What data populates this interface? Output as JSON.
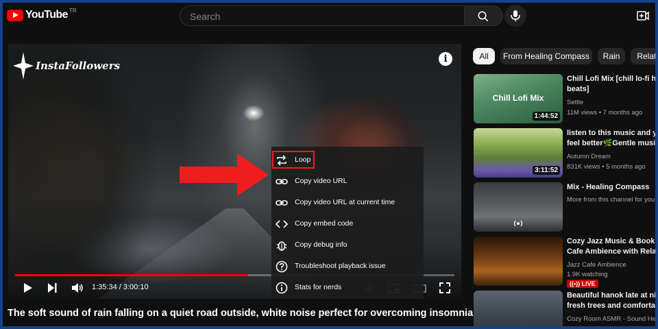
{
  "brand": {
    "name": "YouTube",
    "country": "TR"
  },
  "search": {
    "placeholder": "Search"
  },
  "player": {
    "watermark": "InstaFollowers",
    "progress_fraction": 0.53,
    "time_current": "1:35:34",
    "time_total": "3:00:10",
    "time_display": "1:35:34 / 3:00:10"
  },
  "context_menu": {
    "items": [
      {
        "label": "Loop",
        "icon": "loop-icon"
      },
      {
        "label": "Copy video URL",
        "icon": "link-icon"
      },
      {
        "label": "Copy video URL at current time",
        "icon": "link-icon"
      },
      {
        "label": "Copy embed code",
        "icon": "code-icon"
      },
      {
        "label": "Copy debug info",
        "icon": "bug-icon"
      },
      {
        "label": "Troubleshoot playback issue",
        "icon": "question-icon"
      },
      {
        "label": "Stats for nerds",
        "icon": "info-icon"
      }
    ]
  },
  "video": {
    "title": "The soft sound of rain falling on a quiet road outside, white noise perfect for overcoming insomnia"
  },
  "chips": [
    "All",
    "From Healing Compass",
    "Rain",
    "Related"
  ],
  "recommendations": [
    {
      "title1": "Chill Lofi Mix [chill lo-fi hip",
      "title2": "beats]",
      "channel": "Settle",
      "meta": "11M views • 7 months ago",
      "duration": "1:44:52",
      "thumb_text": "Chill Lofi Mix"
    },
    {
      "title1": "listen to this music and you",
      "title2": "feel better🌿Gentle music o",
      "channel": "Autumn Dream",
      "meta": "831K views • 5 months ago",
      "duration": "3:11:52"
    },
    {
      "title1": "Mix - Healing Compass",
      "title2": "",
      "channel": "More from this channel for you",
      "meta": ""
    },
    {
      "title1": "Cozy Jazz Music & Bookst",
      "title2": "Cafe Ambience with Relaxi",
      "channel": "Jazz Cafe Ambience",
      "meta": "1.9K watching",
      "live": "LIVE"
    },
    {
      "title1": "Beautiful hanok late at nigh",
      "title2": "fresh trees and comfortabl",
      "channel": "Cozy Room ASMR - Sound Hea",
      "meta": ""
    }
  ],
  "colors": {
    "accent": "#ff0000",
    "highlight_box": "#ff1a1a",
    "background": "#0f0f0f"
  }
}
